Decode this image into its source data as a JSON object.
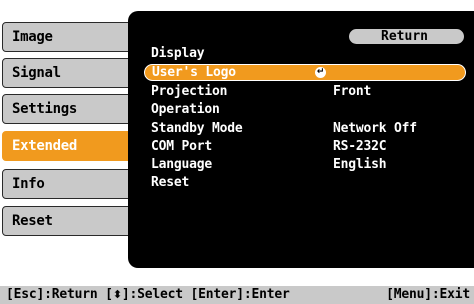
{
  "nav": {
    "items": [
      {
        "label": "Image"
      },
      {
        "label": "Signal"
      },
      {
        "label": "Settings"
      },
      {
        "label": "Extended"
      },
      {
        "label": "Info"
      },
      {
        "label": "Reset"
      }
    ],
    "selected": "Extended"
  },
  "panel": {
    "return_label": "Return",
    "rows": [
      {
        "label": "Display",
        "value": ""
      },
      {
        "label": "User's Logo",
        "value": "",
        "icon": "enter-icon"
      },
      {
        "label": "Projection",
        "value": "Front"
      },
      {
        "label": "Operation",
        "value": ""
      },
      {
        "label": "Standby Mode",
        "value": "Network Off"
      },
      {
        "label": "COM Port",
        "value": "RS-232C"
      },
      {
        "label": "Language",
        "value": "English"
      },
      {
        "label": "Reset",
        "value": ""
      }
    ],
    "highlighted_row": "User's Logo"
  },
  "statusbar": {
    "esc": "[Esc]:Return",
    "select_prefix": "[",
    "select_suffix": "]:Select",
    "enter": "[Enter]:Enter",
    "menu": "[Menu]:Exit"
  },
  "colors": {
    "accent": "#f19a1e",
    "tab_bg": "#c9c9c9",
    "panel_bg": "#000000"
  }
}
